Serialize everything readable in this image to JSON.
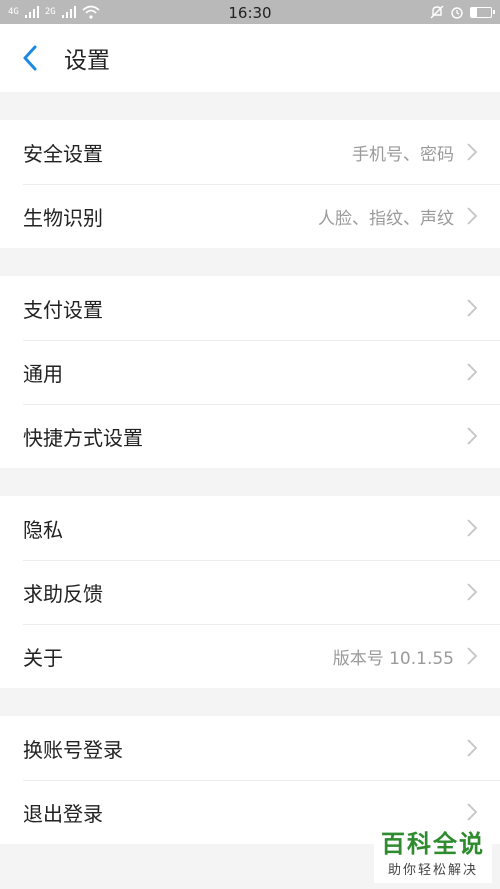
{
  "status_bar": {
    "time": "16:30",
    "signal1": "4G",
    "signal2": "2G"
  },
  "header": {
    "title": "设置"
  },
  "groups": [
    [
      {
        "label": "安全设置",
        "value": "手机号、密码"
      },
      {
        "label": "生物识别",
        "value": "人脸、指纹、声纹"
      }
    ],
    [
      {
        "label": "支付设置",
        "value": ""
      },
      {
        "label": "通用",
        "value": ""
      },
      {
        "label": "快捷方式设置",
        "value": ""
      }
    ],
    [
      {
        "label": "隐私",
        "value": ""
      },
      {
        "label": "求助反馈",
        "value": ""
      },
      {
        "label": "关于",
        "value": "版本号 10.1.55"
      }
    ],
    [
      {
        "label": "换账号登录",
        "value": ""
      },
      {
        "label": "退出登录",
        "value": ""
      }
    ]
  ],
  "watermark": {
    "main": "百科全说",
    "sub": "助你轻松解决"
  },
  "colors": {
    "accent": "#1e88e5",
    "status_bar": "#b9b9b9",
    "background": "#f4f4f4"
  }
}
